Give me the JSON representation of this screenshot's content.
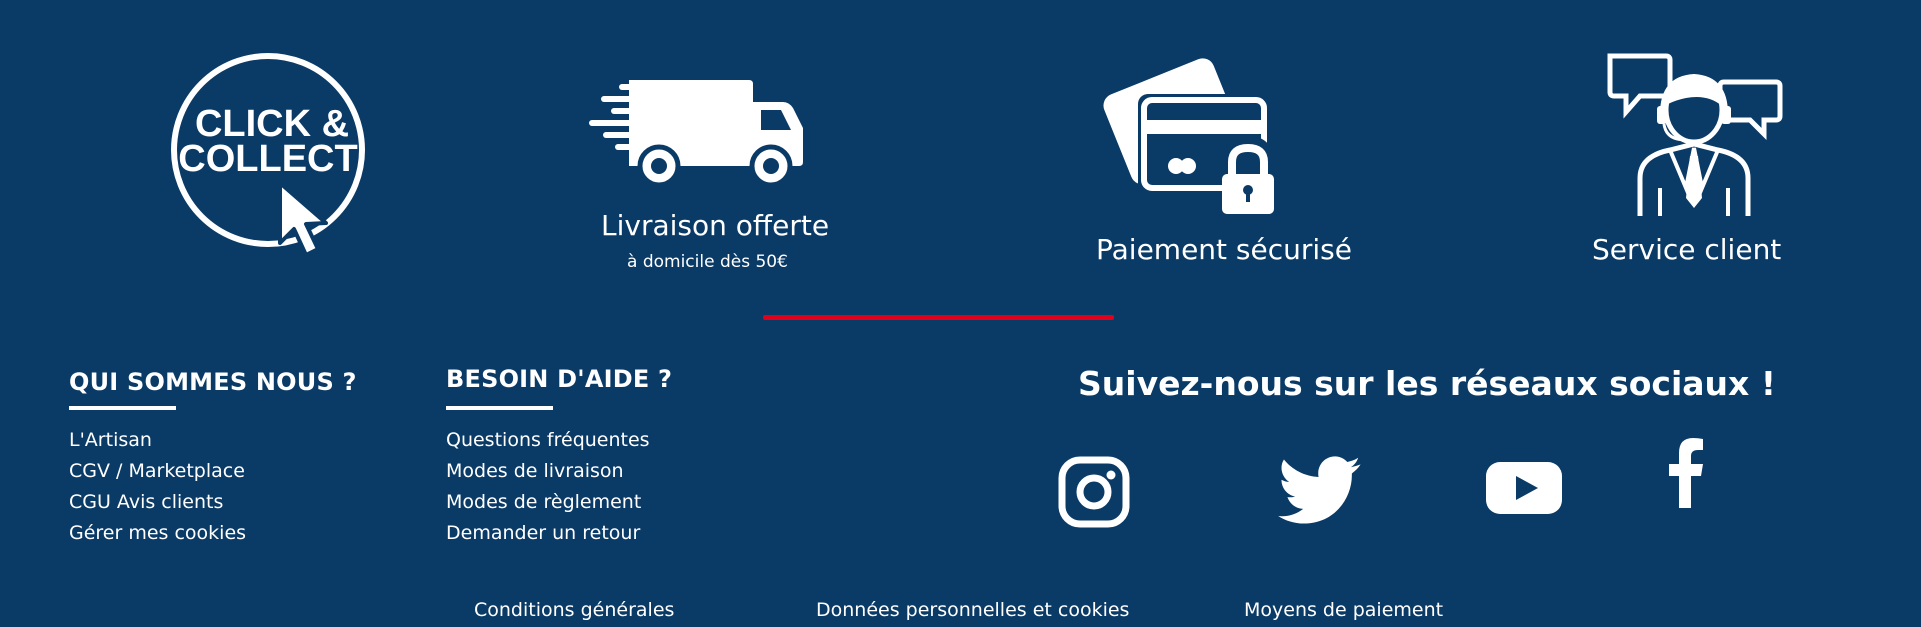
{
  "features": [
    {
      "icon": "click-collect-icon",
      "badge_line1": "CLICK &",
      "badge_line2": "COLLECT"
    },
    {
      "icon": "delivery-truck-icon",
      "label": "Livraison offerte",
      "sublabel": "à domicile dès 50€"
    },
    {
      "icon": "secure-card-icon",
      "label": "Paiement sécurisé"
    },
    {
      "icon": "customer-service-icon",
      "label": "Service client"
    }
  ],
  "colors": {
    "background": "#0a3a66",
    "accent": "#e3001b",
    "text": "#ffffff"
  },
  "about": {
    "title": "QUI SOMMES NOUS ?",
    "links": [
      "L'Artisan",
      "CGV / Marketplace",
      "CGU Avis clients",
      "Gérer mes cookies"
    ]
  },
  "help": {
    "title": "BESOIN D'AIDE ?",
    "links": [
      "Questions fréquentes",
      "Modes de livraison",
      "Modes de règlement",
      "Demander un retour"
    ]
  },
  "social": {
    "title": "Suivez-nous sur les réseaux sociaux !",
    "networks": [
      "instagram-icon",
      "twitter-icon",
      "youtube-icon",
      "facebook-icon"
    ]
  },
  "bottom_links": [
    "Conditions générales",
    "Données personnelles et cookies",
    "Moyens de paiement"
  ]
}
